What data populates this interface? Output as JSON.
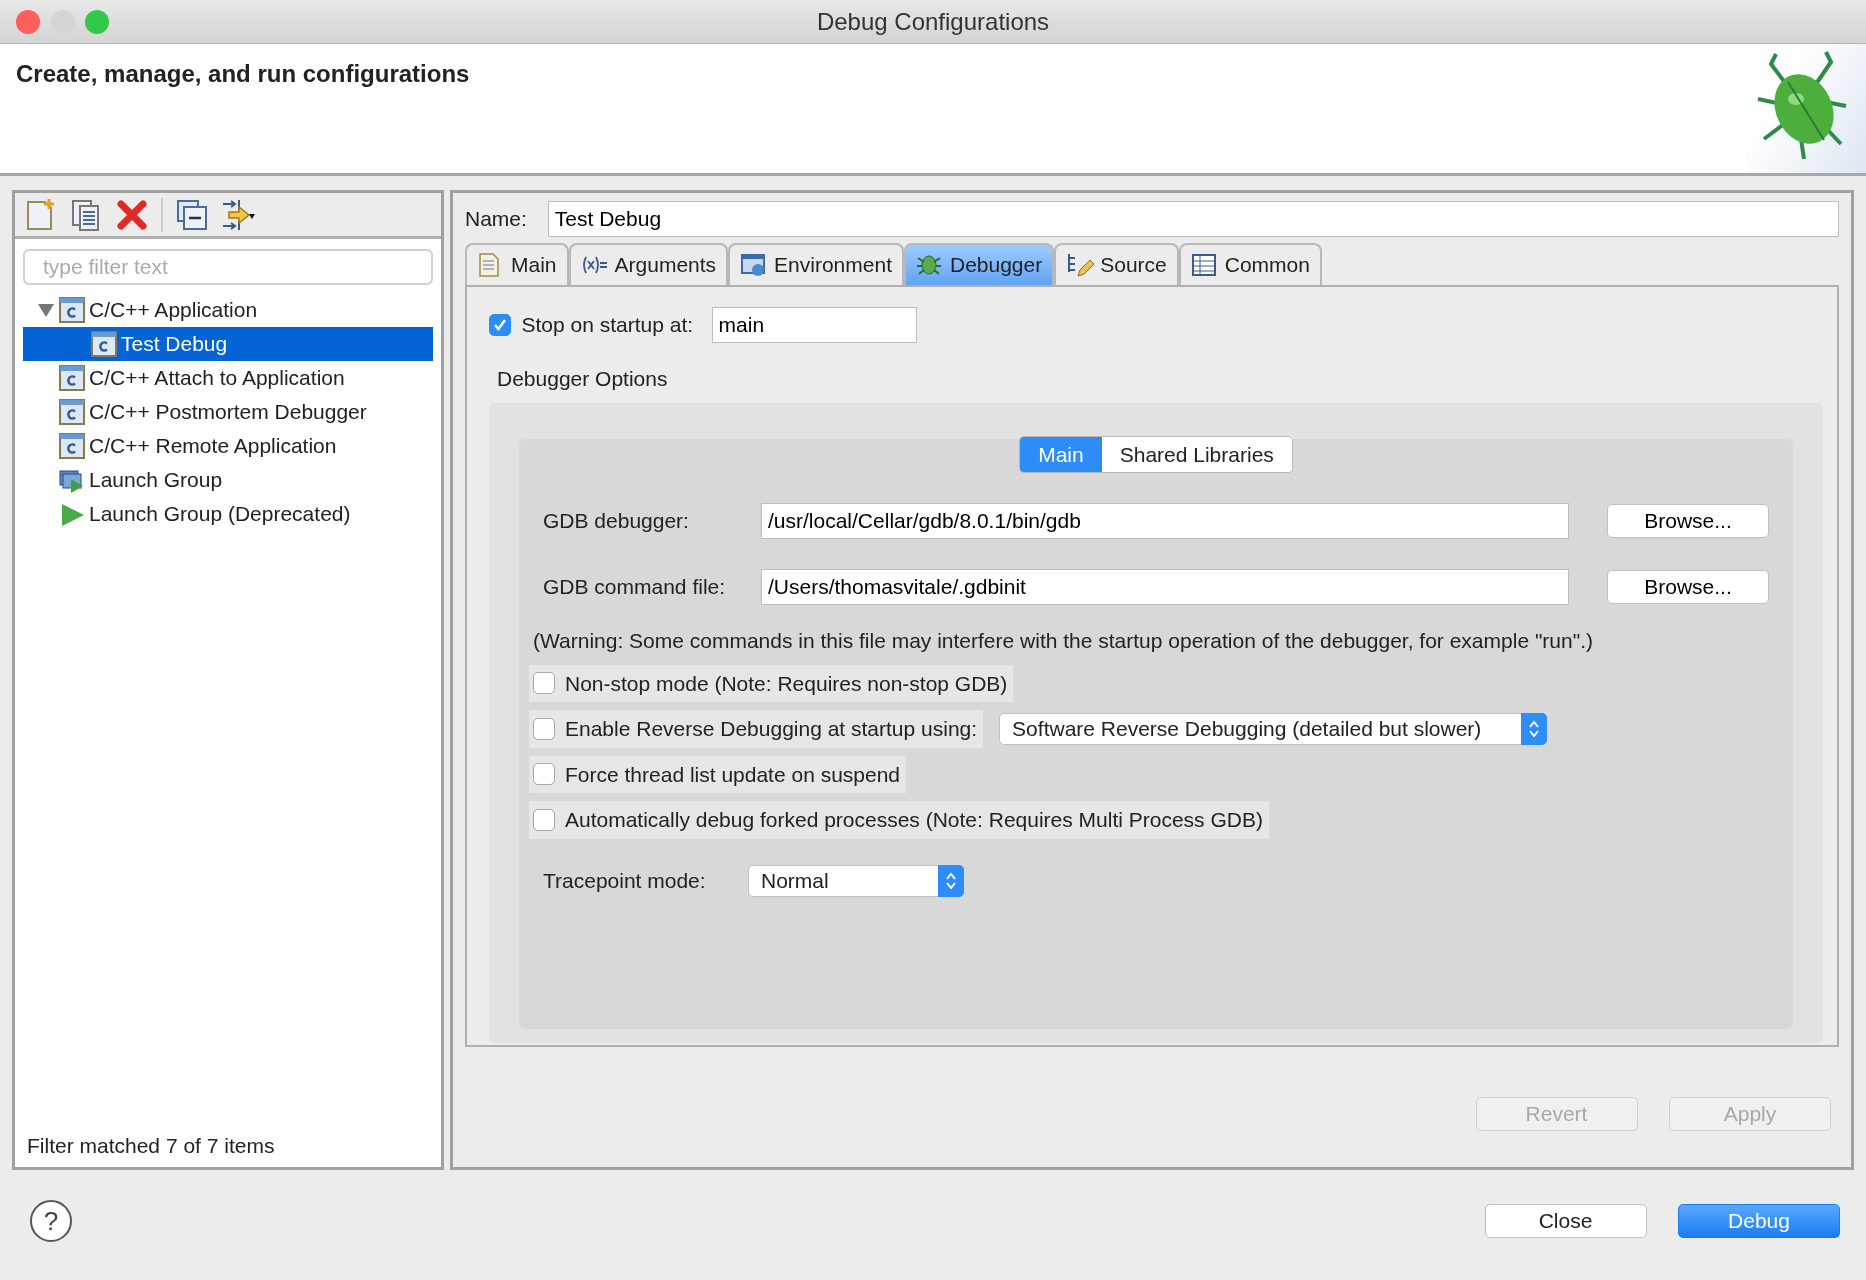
{
  "window": {
    "title": "Debug Configurations"
  },
  "header": {
    "title": "Create, manage, and run configurations"
  },
  "sidebar": {
    "filter": {
      "placeholder": "type filter text"
    },
    "tree": [
      {
        "label": "C/C++ Application",
        "expanded": true,
        "selected": false,
        "children": [
          {
            "label": "Test Debug",
            "selected": true
          }
        ]
      },
      {
        "label": "C/C++ Attach to Application",
        "selected": false
      },
      {
        "label": "C/C++ Postmortem Debugger",
        "selected": false
      },
      {
        "label": "C/C++ Remote Application",
        "selected": false
      },
      {
        "label": "Launch Group",
        "selected": false
      },
      {
        "label": "Launch Group (Deprecated)",
        "selected": false
      }
    ],
    "status": "Filter matched 7 of 7 items"
  },
  "name": {
    "label": "Name:",
    "value": "Test Debug"
  },
  "tabs": [
    {
      "label": "Main",
      "selected": false
    },
    {
      "label": "Arguments",
      "selected": false
    },
    {
      "label": "Environment",
      "selected": false
    },
    {
      "label": "Debugger",
      "selected": true
    },
    {
      "label": "Source",
      "selected": false
    },
    {
      "label": "Common",
      "selected": false
    }
  ],
  "stop_on_startup": {
    "label": "Stop on startup at:",
    "checked": true,
    "value": "main"
  },
  "debugger_options": {
    "title": "Debugger Options",
    "subtabs": [
      {
        "label": "Main",
        "selected": true
      },
      {
        "label": "Shared Libraries",
        "selected": false
      }
    ],
    "fields": [
      {
        "label": "GDB debugger:",
        "value": "/usr/local/Cellar/gdb/8.0.1/bin/gdb",
        "button": "Browse..."
      },
      {
        "label": "GDB command file:",
        "value": "/Users/thomasvitale/.gdbinit",
        "button": "Browse..."
      }
    ],
    "warning": "(Warning: Some commands in this file may interfere with the startup operation of the debugger, for example \"run\".)",
    "options": [
      {
        "kind": "checkbox",
        "label": "Non-stop mode (Note: Requires non-stop GDB)",
        "checked": false
      },
      {
        "kind": "checkbox-select",
        "label": "Enable Reverse Debugging at startup using:",
        "checked": false,
        "select": "Software Reverse Debugging (detailed but slower)"
      },
      {
        "kind": "checkbox",
        "label": "Force thread list update on suspend",
        "checked": false
      },
      {
        "kind": "checkbox",
        "label": "Automatically debug forked processes (Note: Requires Multi Process GDB)",
        "checked": false
      }
    ],
    "tracepoint": {
      "label": "Tracepoint mode:",
      "value": "Normal"
    }
  },
  "actions": [
    {
      "label": "Revert",
      "disabled": true
    },
    {
      "label": "Apply",
      "disabled": true
    }
  ],
  "help": {
    "label": "?"
  },
  "footer_buttons": [
    {
      "label": "Close",
      "primary": false
    },
    {
      "label": "Debug",
      "primary": true
    }
  ]
}
